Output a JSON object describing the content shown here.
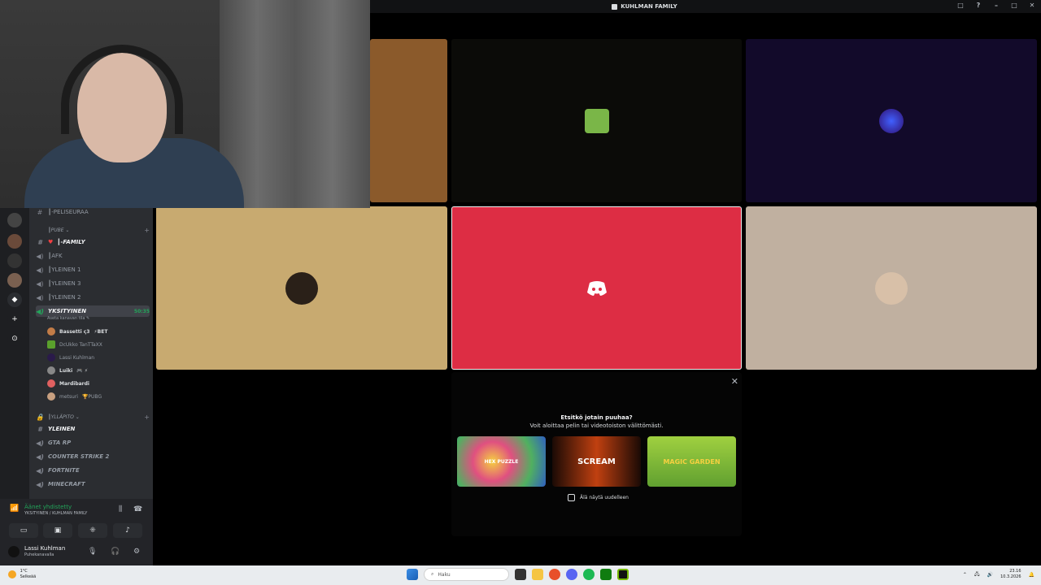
{
  "window": {
    "title": "KUHLMAN FAMILY",
    "controls": [
      "□",
      "?",
      "–",
      "□",
      "✕"
    ]
  },
  "sidebar": {
    "channels": [
      {
        "type": "text",
        "label": "┃-PELISEURAA"
      },
      {
        "type": "category",
        "label": "┃PUBE ⌄"
      },
      {
        "type": "text",
        "label": "┃-FAMILY",
        "bold": true
      },
      {
        "type": "voice",
        "label": "┃AFK"
      },
      {
        "type": "voice",
        "label": "┃YLEINEN 1"
      },
      {
        "type": "voice",
        "label": "┃YLEINEN 3"
      },
      {
        "type": "voice",
        "label": "┃YLEINEN 2"
      },
      {
        "type": "voice",
        "label": "YKSITYINEN",
        "active": true,
        "timer": "50:35",
        "sub": "Aseta kanavan tila ✎"
      },
      {
        "type": "category",
        "label": "┃YLLÄPITO ⌄"
      },
      {
        "type": "text",
        "label": "YLEINEN",
        "bold": true
      },
      {
        "type": "voice",
        "label": "GTA RP"
      },
      {
        "type": "voice",
        "label": "COUNTER STRIKE 2"
      },
      {
        "type": "voice",
        "label": "FORTNITE"
      },
      {
        "type": "voice",
        "label": "MINECRAFT"
      }
    ],
    "members": [
      {
        "name": "Bassetti ς3",
        "tag": "⚡BET",
        "color": "#c27c47",
        "bold": true
      },
      {
        "name": "DcUkko TanTTaXX",
        "tag": "",
        "color": "#5aa02c",
        "bold": false
      },
      {
        "name": "Lassi Kuhlman",
        "tag": "",
        "color": "#2a1a4a",
        "bold": false
      },
      {
        "name": "Luiki",
        "tag": "🎮 ⚡",
        "color": "#888",
        "bold": true
      },
      {
        "name": "Mardibardi",
        "tag": "",
        "color": "#e06060",
        "bold": true
      },
      {
        "name": "metsuri",
        "tag": "🏆PUBG",
        "color": "#c8a080",
        "bold": false
      }
    ],
    "voice_panel": {
      "status": "Äänet yhdistetty",
      "channel": "YKSITYINEN / KUHLMAN FAMILY"
    },
    "user": {
      "name": "Lassi Kuhlman",
      "status": "Puhekanavalla"
    }
  },
  "activity": {
    "title": "Etsitkö jotain puuhaa?",
    "subtitle": "Voit aloittaa pelin tai videotoiston välittömästi.",
    "games": [
      "HEX PUZZLE",
      "SCREAM",
      "MAGIC GARDEN"
    ],
    "checkbox_label": "Älä näytä uudelleen"
  },
  "taskbar": {
    "weather_temp": "1°C",
    "weather_desc": "Selkeää",
    "search_placeholder": "Haku",
    "time": "23.16",
    "date": "10.3.2026"
  },
  "colors": {
    "tile_orange": "#8b5a2b",
    "tile_dark": "#0b0b08",
    "tile_purple": "#120a2a",
    "tile_tan": "#c8aa70",
    "tile_red": "#dd2d44",
    "tile_beige": "#c0b0a0",
    "voice_green": "#23a55a"
  }
}
